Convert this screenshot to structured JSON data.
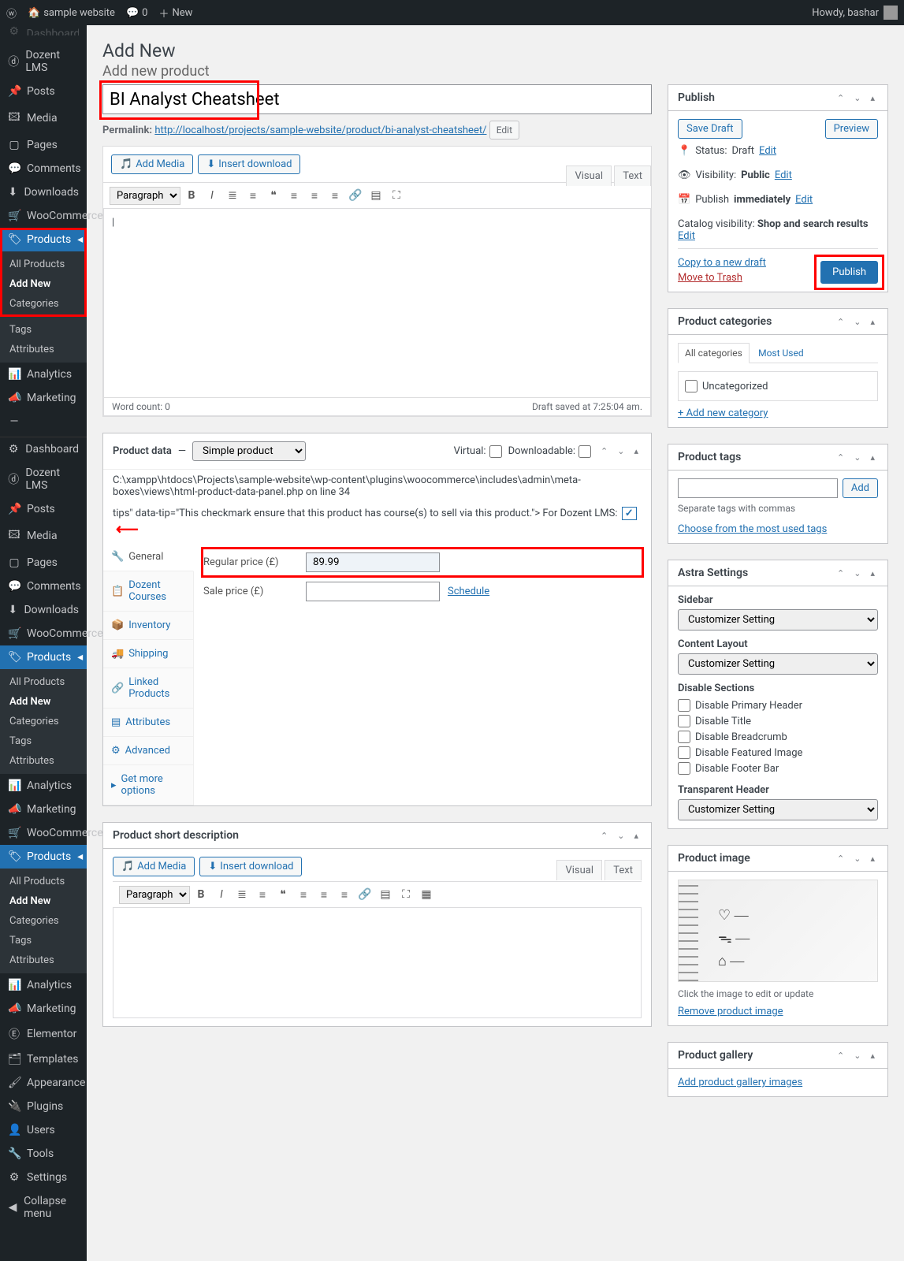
{
  "toolbar": {
    "site_name": "sample website",
    "comments": "0",
    "new": "New",
    "howdy": "Howdy, bashar"
  },
  "page": {
    "heading": "Add New",
    "add_new_product": "Add new product"
  },
  "sidebar": {
    "dashboard_cut": "Dashboard",
    "items1": [
      {
        "icon": "ⓓ",
        "label": "Dozent LMS"
      },
      {
        "icon": "📌",
        "label": "Posts"
      },
      {
        "icon": "🖾",
        "label": "Media"
      },
      {
        "icon": "▢",
        "label": "Pages"
      },
      {
        "icon": "💬",
        "label": "Comments"
      },
      {
        "icon": "⬇",
        "label": "Downloads"
      },
      {
        "icon": "🛒",
        "label": "WooCommerce"
      }
    ],
    "products": "Products",
    "products_sub": [
      "All Products",
      "Add New",
      "Categories",
      "Tags",
      "Attributes"
    ],
    "items2": [
      {
        "icon": "📊",
        "label": "Analytics"
      },
      {
        "icon": "📣",
        "label": "Marketing"
      },
      {
        "icon": "—",
        "label": ""
      }
    ],
    "items3": [
      {
        "icon": "⚙",
        "label": "Dashboard"
      },
      {
        "icon": "ⓓ",
        "label": "Dozent LMS"
      },
      {
        "icon": "📌",
        "label": "Posts"
      },
      {
        "icon": "🖾",
        "label": "Media"
      },
      {
        "icon": "▢",
        "label": "Pages"
      },
      {
        "icon": "💬",
        "label": "Comments"
      },
      {
        "icon": "⬇",
        "label": "Downloads"
      },
      {
        "icon": "🛒",
        "label": "WooCommerce"
      }
    ],
    "items4": [
      {
        "icon": "📊",
        "label": "Analytics"
      },
      {
        "icon": "📣",
        "label": "Marketing"
      },
      {
        "icon": "🛒",
        "label": "WooCommerce"
      }
    ],
    "items5": [
      {
        "icon": "📊",
        "label": "Analytics"
      },
      {
        "icon": "📣",
        "label": "Marketing"
      },
      {
        "icon": "Ⓔ",
        "label": "Elementor"
      },
      {
        "icon": "🗂",
        "label": "Templates"
      },
      {
        "icon": "🖌",
        "label": "Appearance"
      },
      {
        "icon": "🔌",
        "label": "Plugins"
      },
      {
        "icon": "👤",
        "label": "Users"
      },
      {
        "icon": "🔧",
        "label": "Tools"
      },
      {
        "icon": "⚙",
        "label": "Settings"
      },
      {
        "icon": "◀",
        "label": "Collapse menu"
      }
    ]
  },
  "title": {
    "value": "BI Analyst Cheatsheet"
  },
  "permalink": {
    "label": "Permalink:",
    "url_prefix": "http://localhost/projects/sample-website/product/",
    "slug": "bi-analyst-cheatsheet/",
    "edit": "Edit"
  },
  "editor": {
    "add_media": "Add Media",
    "insert_download": "Insert download",
    "visual": "Visual",
    "text": "Text",
    "paragraph": "Paragraph",
    "word_count": "Word count: 0",
    "draft_saved": "Draft saved at 7:25:04 am."
  },
  "product_data": {
    "title": "Product data",
    "type": "Simple product",
    "virtual": "Virtual:",
    "downloadable": "Downloadable:",
    "debug_line": "C:\\xampp\\htdocs\\Projects\\sample-website\\wp-content\\plugins\\woocommerce\\includes\\admin\\meta-boxes\\views\\html-product-data-panel.php on line 34",
    "debug_tip": "tips\" data-tip=\"This checkmark ensure that this product has course(s) to sell via this product.\"> For Dozent LMS:",
    "tabs": [
      {
        "icon": "🔧",
        "label": "General"
      },
      {
        "icon": "📋",
        "label": "Dozent Courses"
      },
      {
        "icon": "📦",
        "label": "Inventory"
      },
      {
        "icon": "🚚",
        "label": "Shipping"
      },
      {
        "icon": "🔗",
        "label": "Linked Products"
      },
      {
        "icon": "▤",
        "label": "Attributes"
      },
      {
        "icon": "⚙",
        "label": "Advanced"
      },
      {
        "icon": "▸",
        "label": "Get more options"
      }
    ],
    "regular_price_label": "Regular price (£)",
    "regular_price": "89.99",
    "sale_price_label": "Sale price (£)",
    "schedule": "Schedule"
  },
  "short_desc": {
    "title": "Product short description"
  },
  "publish": {
    "title": "Publish",
    "save_draft": "Save Draft",
    "preview": "Preview",
    "status_label": "Status:",
    "status": "Draft",
    "visibility_label": "Visibility:",
    "visibility": "Public",
    "publish_label": "Publish",
    "publish_val": "immediately",
    "catalog_label": "Catalog visibility:",
    "catalog_val": "Shop and search results",
    "edit": "Edit",
    "copy": "Copy to a new draft",
    "trash": "Move to Trash",
    "publish_btn": "Publish"
  },
  "categories": {
    "title": "Product categories",
    "all": "All categories",
    "most_used": "Most Used",
    "uncategorized": "Uncategorized",
    "add_new": "+ Add new category"
  },
  "tags": {
    "title": "Product tags",
    "add": "Add",
    "separate": "Separate tags with commas",
    "choose": "Choose from the most used tags"
  },
  "astra": {
    "title": "Astra Settings",
    "sidebar": "Sidebar",
    "customizer": "Customizer Setting",
    "content_layout": "Content Layout",
    "disable_sections": "Disable Sections",
    "disable_items": [
      "Disable Primary Header",
      "Disable Title",
      "Disable Breadcrumb",
      "Disable Featured Image",
      "Disable Footer Bar"
    ],
    "transparent_header": "Transparent Header"
  },
  "product_image": {
    "title": "Product image",
    "click": "Click the image to edit or update",
    "remove": "Remove product image"
  },
  "gallery": {
    "title": "Product gallery",
    "add": "Add product gallery images"
  }
}
